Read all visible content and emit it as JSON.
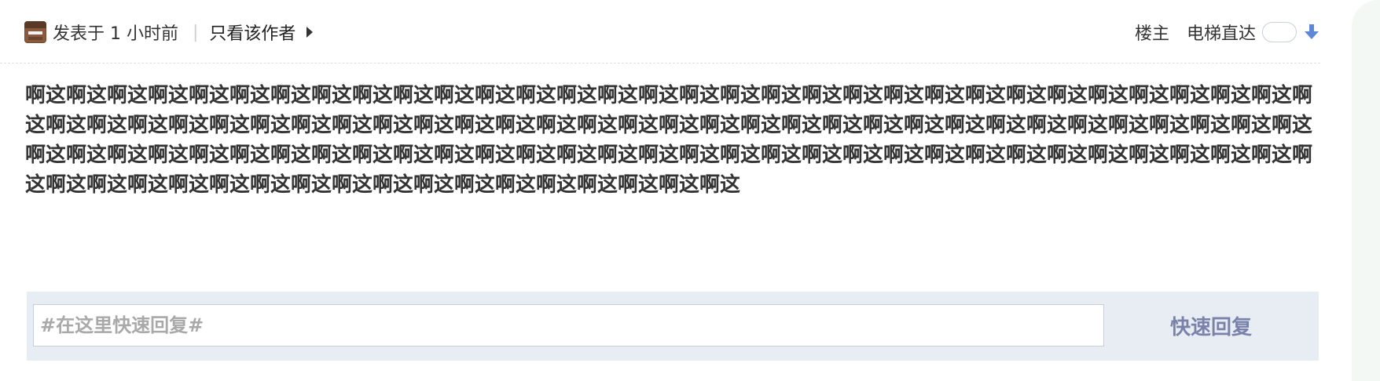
{
  "post": {
    "meta": {
      "published": "发表于 1 小时前",
      "separator": "|",
      "only_author": "只看该作者"
    },
    "tools": {
      "floor": "楼主",
      "jump": "电梯直达"
    },
    "content": "啊这啊这啊这啊这啊这啊这啊这啊这啊这啊这啊这啊这啊这啊这啊这啊这啊这啊这啊这啊这啊这啊这啊这啊这啊这啊这啊这啊这啊这啊这啊这啊这啊这啊这啊这啊这啊这啊这啊这啊这啊这啊这啊这啊这啊这啊这啊这啊这啊这啊这啊这啊这啊这啊这啊这啊这啊这啊这啊这啊这啊这啊这啊这啊这啊这啊这啊这啊这啊这啊这啊这啊这啊这啊这啊这啊这啊这啊这啊这啊这啊这啊这啊这啊这啊这啊这啊这啊这啊这啊这啊这啊这啊这啊这啊这啊这啊这啊这啊这啊这啊这啊这啊这啊这啊这啊这啊这啊这啊这啊这啊这啊这"
  },
  "reply": {
    "placeholder": "#在这里快速回复#",
    "button": "快速回复"
  },
  "colors": {
    "accent_blue": "#5f87d9",
    "reply_button": "#7b82aa",
    "reply_bar": "#e7edf3"
  },
  "icons": {
    "avatar": "avatar",
    "more": "caret-right-icon",
    "jump": "down-arrow-icon"
  }
}
